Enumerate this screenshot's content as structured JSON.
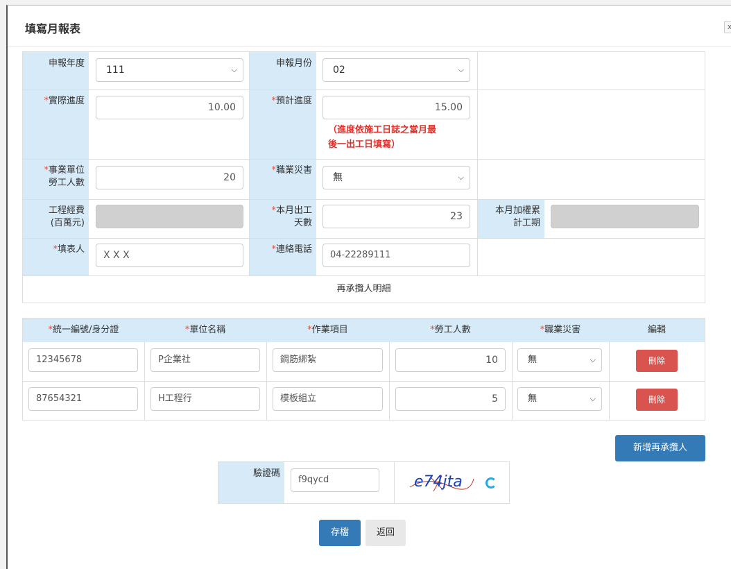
{
  "modal": {
    "title": "填寫月報表",
    "close_glyph": "x"
  },
  "form": {
    "year_label": "申報年度",
    "year_value": "111",
    "month_label": "申報月份",
    "month_value": "02",
    "actual_progress_label": "實際進度",
    "actual_progress_value": "10.00",
    "planned_progress_label": "預計進度",
    "planned_progress_value": "15.00",
    "progress_note_line1": "（進度依施工日誌之當月最",
    "progress_note_line2": "後一出工日填寫）",
    "workers_label_1": "事業單位",
    "workers_label_2": "勞工人數",
    "workers_value": "20",
    "accident_label": "職業災害",
    "accident_value": "無",
    "budget_label_1": "工程經費",
    "budget_label_2": "(百萬元)",
    "workdays_label_1": "本月出工",
    "workdays_label_2": "天數",
    "workdays_value": "23",
    "cumulative_label_1": "本月加權累",
    "cumulative_label_2": "計工期",
    "filler_label": "填表人",
    "filler_value": "X X X",
    "phone_label": "連絡電話",
    "phone_value": "04-22289111",
    "subcontractor_section": "再承攬人明細"
  },
  "table": {
    "headers": {
      "id": "統一編號/身分證",
      "name": "單位名稱",
      "task": "作業項目",
      "workers": "勞工人數",
      "accident": "職業災害",
      "edit": "編輯"
    },
    "rows": [
      {
        "id": "12345678",
        "name": "P企業社",
        "task": "鋼筋綁紮",
        "workers": "10",
        "accident": "無",
        "delete": "刪除"
      },
      {
        "id": "87654321",
        "name": "H工程行",
        "task": "模板組立",
        "workers": "5",
        "accident": "無",
        "delete": "刪除"
      }
    ]
  },
  "add_subcontractor_button": "新增再承攬人",
  "captcha": {
    "label": "驗證碼",
    "value": "f9qycd",
    "image_text": "e74jta"
  },
  "footer": {
    "save_button": "存檔",
    "back_button": "返回"
  },
  "colors": {
    "label_bg": "#d6eaf8",
    "primary": "#337ab7",
    "danger": "#d9534f",
    "required_star": "#e74c3c"
  }
}
